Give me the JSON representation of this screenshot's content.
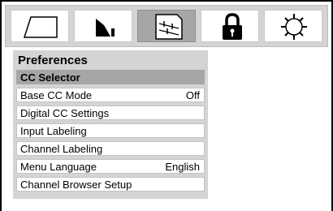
{
  "tabs": [
    {
      "icon": "picture-icon"
    },
    {
      "icon": "sound-icon"
    },
    {
      "icon": "preferences-icon",
      "active": true
    },
    {
      "icon": "lock-icon"
    },
    {
      "icon": "setup-gear-icon"
    }
  ],
  "menu": {
    "title": "Preferences",
    "items": [
      {
        "label": "CC Selector",
        "value": ""
      },
      {
        "label": "Base CC Mode",
        "value": "Off"
      },
      {
        "label": "Digital CC Settings",
        "value": ""
      },
      {
        "label": "Input Labeling",
        "value": ""
      },
      {
        "label": "Channel Labeling",
        "value": ""
      },
      {
        "label": "Menu Language",
        "value": "English"
      },
      {
        "label": "Channel Browser Setup",
        "value": ""
      }
    ]
  }
}
